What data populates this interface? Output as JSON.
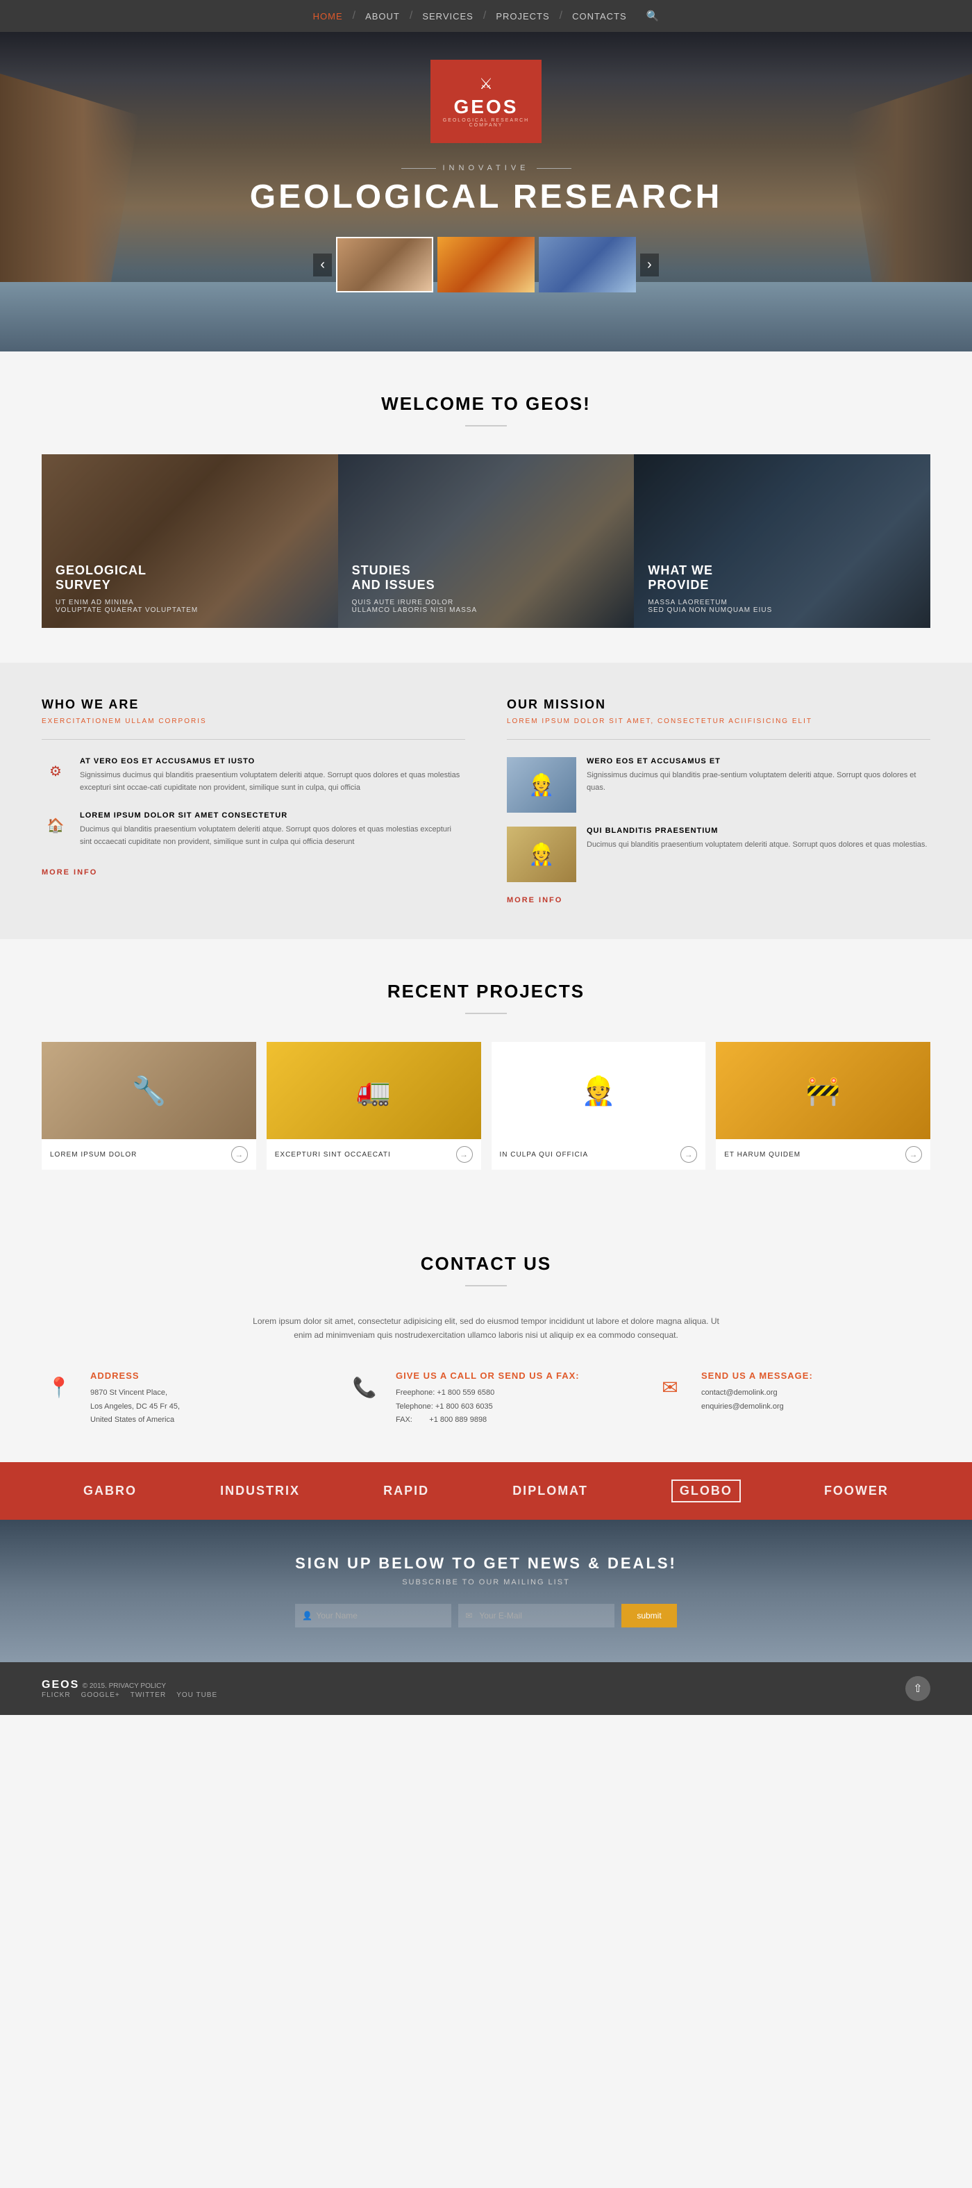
{
  "nav": {
    "items": [
      {
        "label": "HOME",
        "href": "#",
        "active": true
      },
      {
        "label": "ABOUT",
        "href": "#"
      },
      {
        "label": "SERVICES",
        "href": "#"
      },
      {
        "label": "PROJECTS",
        "href": "#"
      },
      {
        "label": "CONTACTS",
        "href": "#"
      }
    ]
  },
  "hero": {
    "tagline": "INNOVATIVE",
    "title": "GEOLOGICAL RESEARCH",
    "thumbnails": [
      {
        "id": "thumb1",
        "type": "canyon",
        "active": true
      },
      {
        "id": "thumb2",
        "type": "sunset",
        "active": false
      },
      {
        "id": "thumb3",
        "type": "sky",
        "active": false
      }
    ]
  },
  "logo": {
    "name": "GEOS",
    "subtitle": "GEOLOGICAL RESEARCH COMPANY"
  },
  "welcome": {
    "title": "WELCOME TO GEOS!",
    "services": [
      {
        "bg": "geological",
        "title": "GEOLOGICAL\nSURVEY",
        "desc": "UT ENIM AD MINIMA\nVOLUPTATE QUAERAT VOLUPTATEM"
      },
      {
        "bg": "studies",
        "title": "STUDIES\nAND ISSUES",
        "desc": "QUIS AUTE IRURE DOLOR\nULLAMCO LABORIS NISI MASSA"
      },
      {
        "bg": "provide",
        "title": "WHAT WE\nPROVIDE",
        "desc": "MASSA LAOREETUM\nSED QUIA NON NUMQUAM EIUS"
      }
    ]
  },
  "who": {
    "title": "WHO WE ARE",
    "subtitle": "EXERCITATIONEM ULLAM CORPORIS",
    "items": [
      {
        "icon": "⚙",
        "title": "AT VERO EOS ET ACCUSAMUS ET IUSTO",
        "desc": "Signissimus ducimus qui blanditis praesentium voluptatem deleriti atque. Sorrupt quos dolores et quas molestias excepturi sint occae-cati cupiditate non provident, similique sunt in culpa, qui officia"
      },
      {
        "icon": "🏠",
        "title": "LOREM IPSUM DOLOR SIT AMET CONSECTETUR",
        "desc": "Ducimus qui blanditis praesentium voluptatem deleriti atque. Sorrupt quos dolores et quas molestias excepturi sint occaecati cupiditate non provident, similique sunt in culpa qui officia deserunt"
      }
    ],
    "more_info": "MORE INFO"
  },
  "mission": {
    "title": "OUR MISSION",
    "subtitle": "LOREM IPSUM DOLOR SIT AMET, CONSECTETUR ACIIFISICING ELIT",
    "items": [
      {
        "type": "blue",
        "title": "WERO EOS ET ACCUSAMUS ET",
        "desc": "Signissimus ducimus qui blanditis prae-sentium voluptatem deleriti atque. Sorrupt quos dolores et quas."
      },
      {
        "type": "yellow",
        "title": "QUI BLANDITIS PRAESENTIUM",
        "desc": "Ducimus qui blanditis praesentium voluptatem deleriti atque. Sorrupt quos dolores et quas molestias."
      }
    ],
    "more_info": "MORE INFO"
  },
  "projects": {
    "title": "RECENT PROJECTS",
    "items": [
      {
        "bg": "p1",
        "label": "LOREM IPSUM DOLOR",
        "icon": "→"
      },
      {
        "bg": "p2",
        "label": "EXCEPTURI SINT OCCAECATI",
        "icon": "→"
      },
      {
        "bg": "p3",
        "label": "IN CULPA QUI OFFICIA",
        "icon": "→"
      },
      {
        "bg": "p4",
        "label": "ET HARUM QUIDEM",
        "icon": "→"
      }
    ]
  },
  "contact": {
    "title": "CONTACT US",
    "intro": "Lorem ipsum dolor sit amet, consectetur adipisicing elit, sed do eiusmod tempor incididunt ut labore et dolore magna aliqua. Ut enim ad minimveniam quis nostrudexercitation ullamco laboris nisi ut aliquip ex ea commodo consequat.",
    "address": {
      "label": "ADDRESS",
      "lines": [
        "9870 St Vincent Place,",
        "Los Angeles, DC 45 Fr 45,",
        "United States of America"
      ]
    },
    "phone": {
      "label": "Give us a call or send us a fax:",
      "freephone": "Freephone: +1 800 559 6580",
      "telephone": "Telephone: +1 800 603 6035",
      "fax": "FAX:        +1 800 889 9898"
    },
    "email": {
      "label": "Send us a message:",
      "emails": [
        "contact@demolink.org",
        "enquiries@demolink.org"
      ]
    }
  },
  "partners": [
    "GABRO",
    "INDUSTRIX",
    "RAPID",
    "DIPLOMAT",
    "GLOBO",
    "FOOWER"
  ],
  "newsletter": {
    "title": "SIGN UP BELOW TO GET NEWS & DEALS!",
    "subtitle": "SUBSCRIBE TO OUR MAILING LIST",
    "name_placeholder": "Your Name",
    "email_placeholder": "Your E-Mail",
    "submit_label": "submit"
  },
  "footer": {
    "brand": "GEOS",
    "copyright": "© 2015. PRIVACY POLICY",
    "links": [
      "FLICKR",
      "GOOGLE+",
      "TWITTER",
      "YOU TUBE"
    ]
  }
}
